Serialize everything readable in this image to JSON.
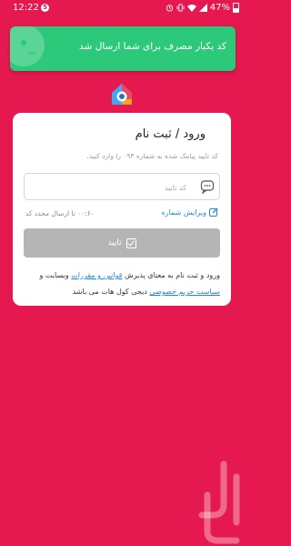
{
  "status_bar": {
    "time": "12:22",
    "notification_badge": "5",
    "battery": "47%"
  },
  "toast": {
    "message": "کد یکبار مصرف برای شما ارسال شد"
  },
  "card": {
    "title": "ورود / ثبت نام",
    "instruction": "کد تایید پیامک شده به شماره ۰۹۳ را وارد کنید.",
    "code_input": {
      "placeholder": "کد تایید",
      "value": ""
    },
    "edit_number": "ویرایش شماره",
    "resend_timer": "۰۰:۶۰  تا ارسال مجدد کد",
    "confirm_button": "تایید",
    "terms": {
      "before": "ورود و ثبت نام به معنای پذیرش ",
      "link_terms": "قوانین و مقررات",
      "middle": " وبسایت و ",
      "link_privacy": "سیاست حریم خصوصی",
      "after": " دیجی کول هات می باشد"
    }
  },
  "colors": {
    "background": "#E5194F",
    "toast": "#2DC97A",
    "link": "#1E88E5",
    "button_disabled": "#B5B5B5"
  }
}
